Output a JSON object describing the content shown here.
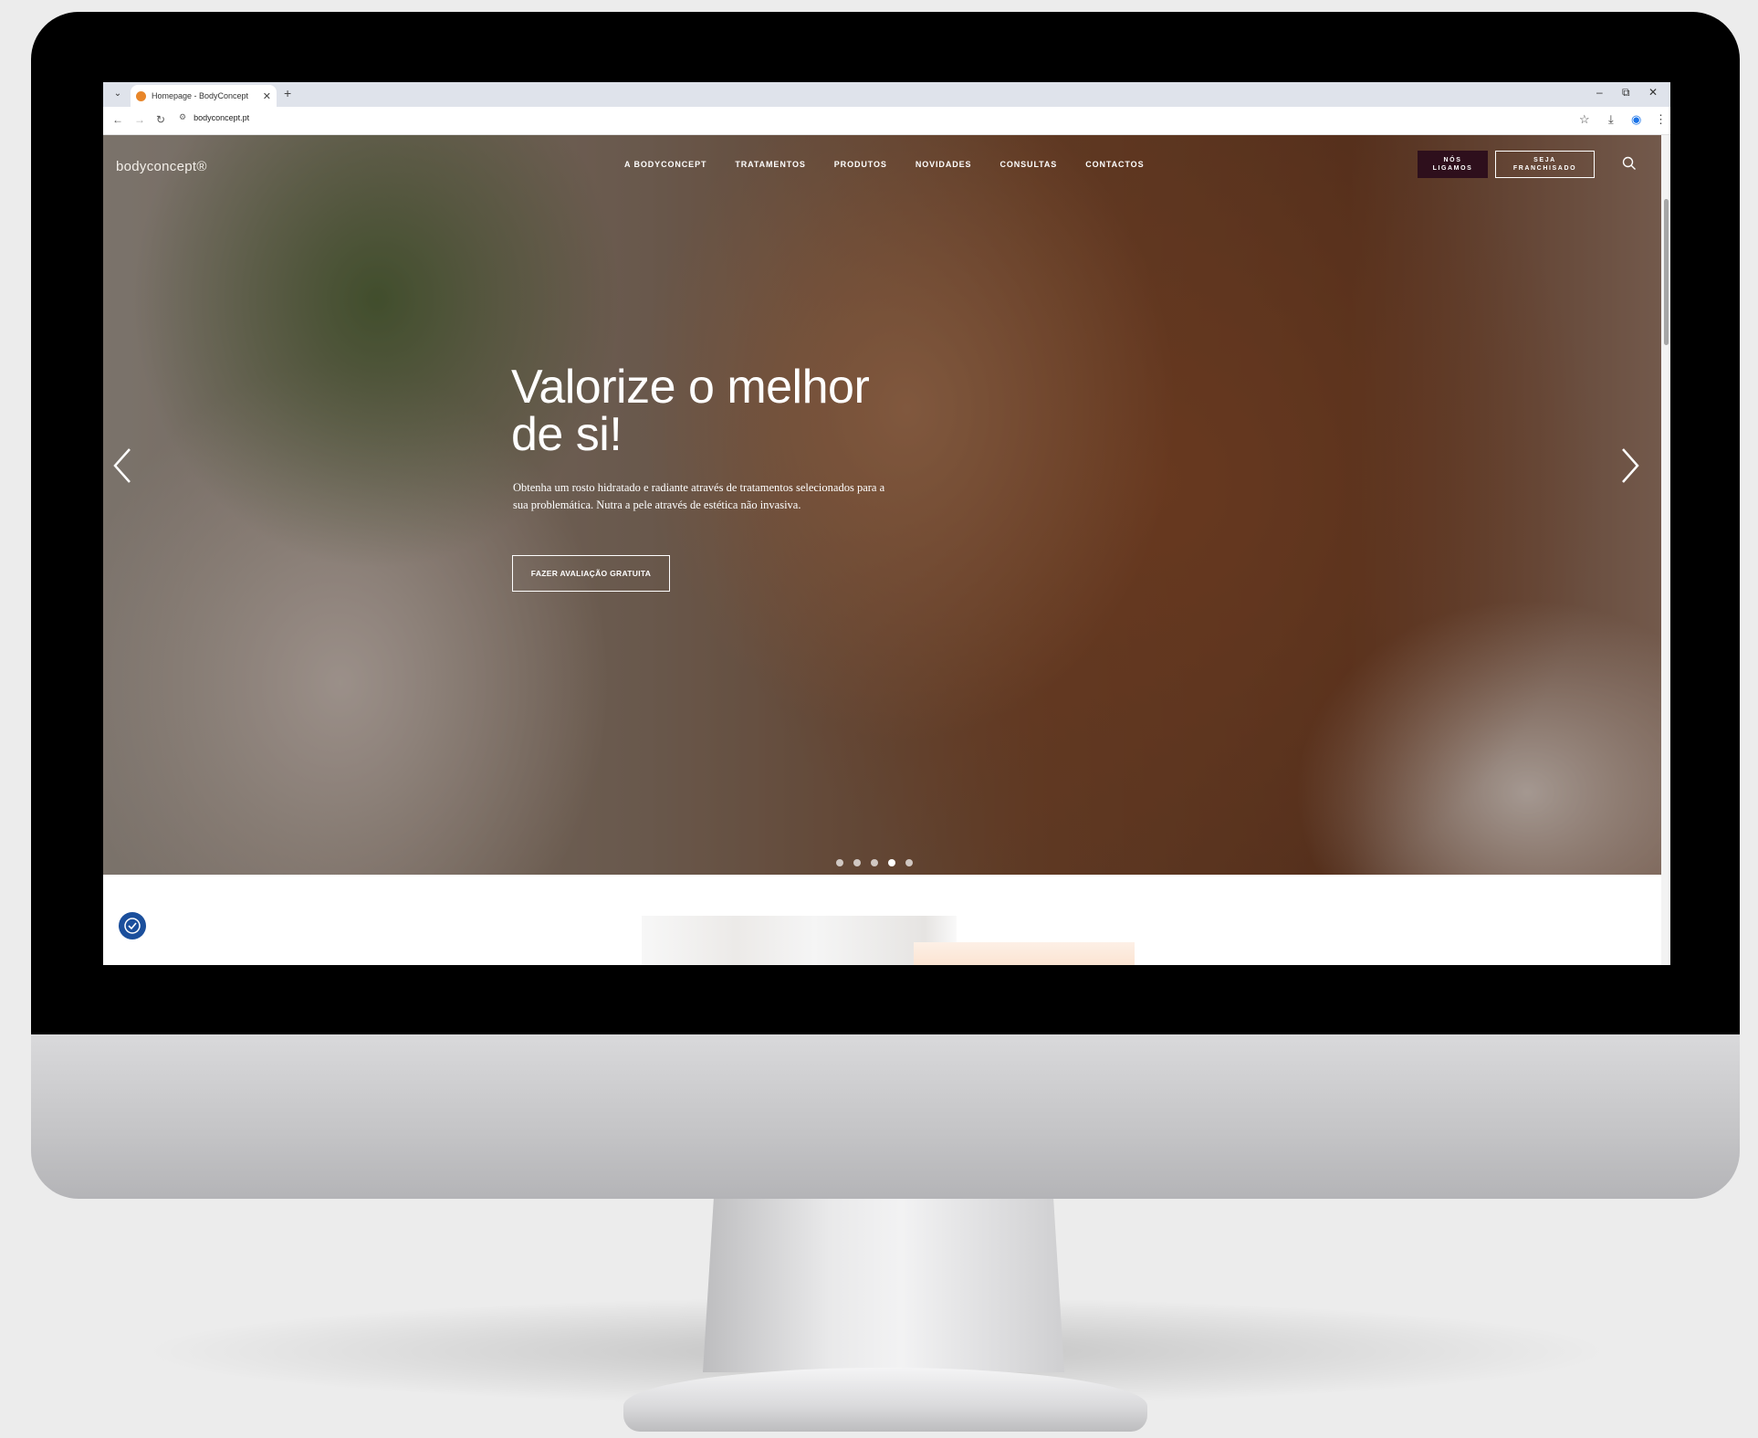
{
  "browser": {
    "tab_title": "Homepage - BodyConcept",
    "tab_close": "✕",
    "new_tab": "+",
    "url": "bodyconcept.pt",
    "win_minimize": "–",
    "win_restore": "⧉",
    "win_close": "✕"
  },
  "site": {
    "logo": "bodyconcept®",
    "nav": [
      "A BODYCONCEPT",
      "TRATAMENTOS",
      "PRODUTOS",
      "NOVIDADES",
      "CONSULTAS",
      "CONTACTOS"
    ],
    "btn_call": "NÓS LIGAMOS",
    "btn_franchise": "SEJA FRANCHISADO"
  },
  "hero": {
    "headline": "Valorize o melhor de si!",
    "subtext": "Obtenha um rosto hidratado e radiante através de tratamentos selecionados para a sua problemática. Nutra a pele através de estética não invasiva.",
    "cta": "FAZER AVALIAÇÃO GRATUITA",
    "slides_total": 5,
    "active_slide": 4
  },
  "colors": {
    "accent_dark": "#2e0f1c",
    "a11y_blue": "#1b4f9c"
  },
  "icons": {
    "prev": "chevron-left-icon",
    "next": "chevron-right-icon",
    "search": "search-icon",
    "accessibility": "accessibility-icon"
  }
}
